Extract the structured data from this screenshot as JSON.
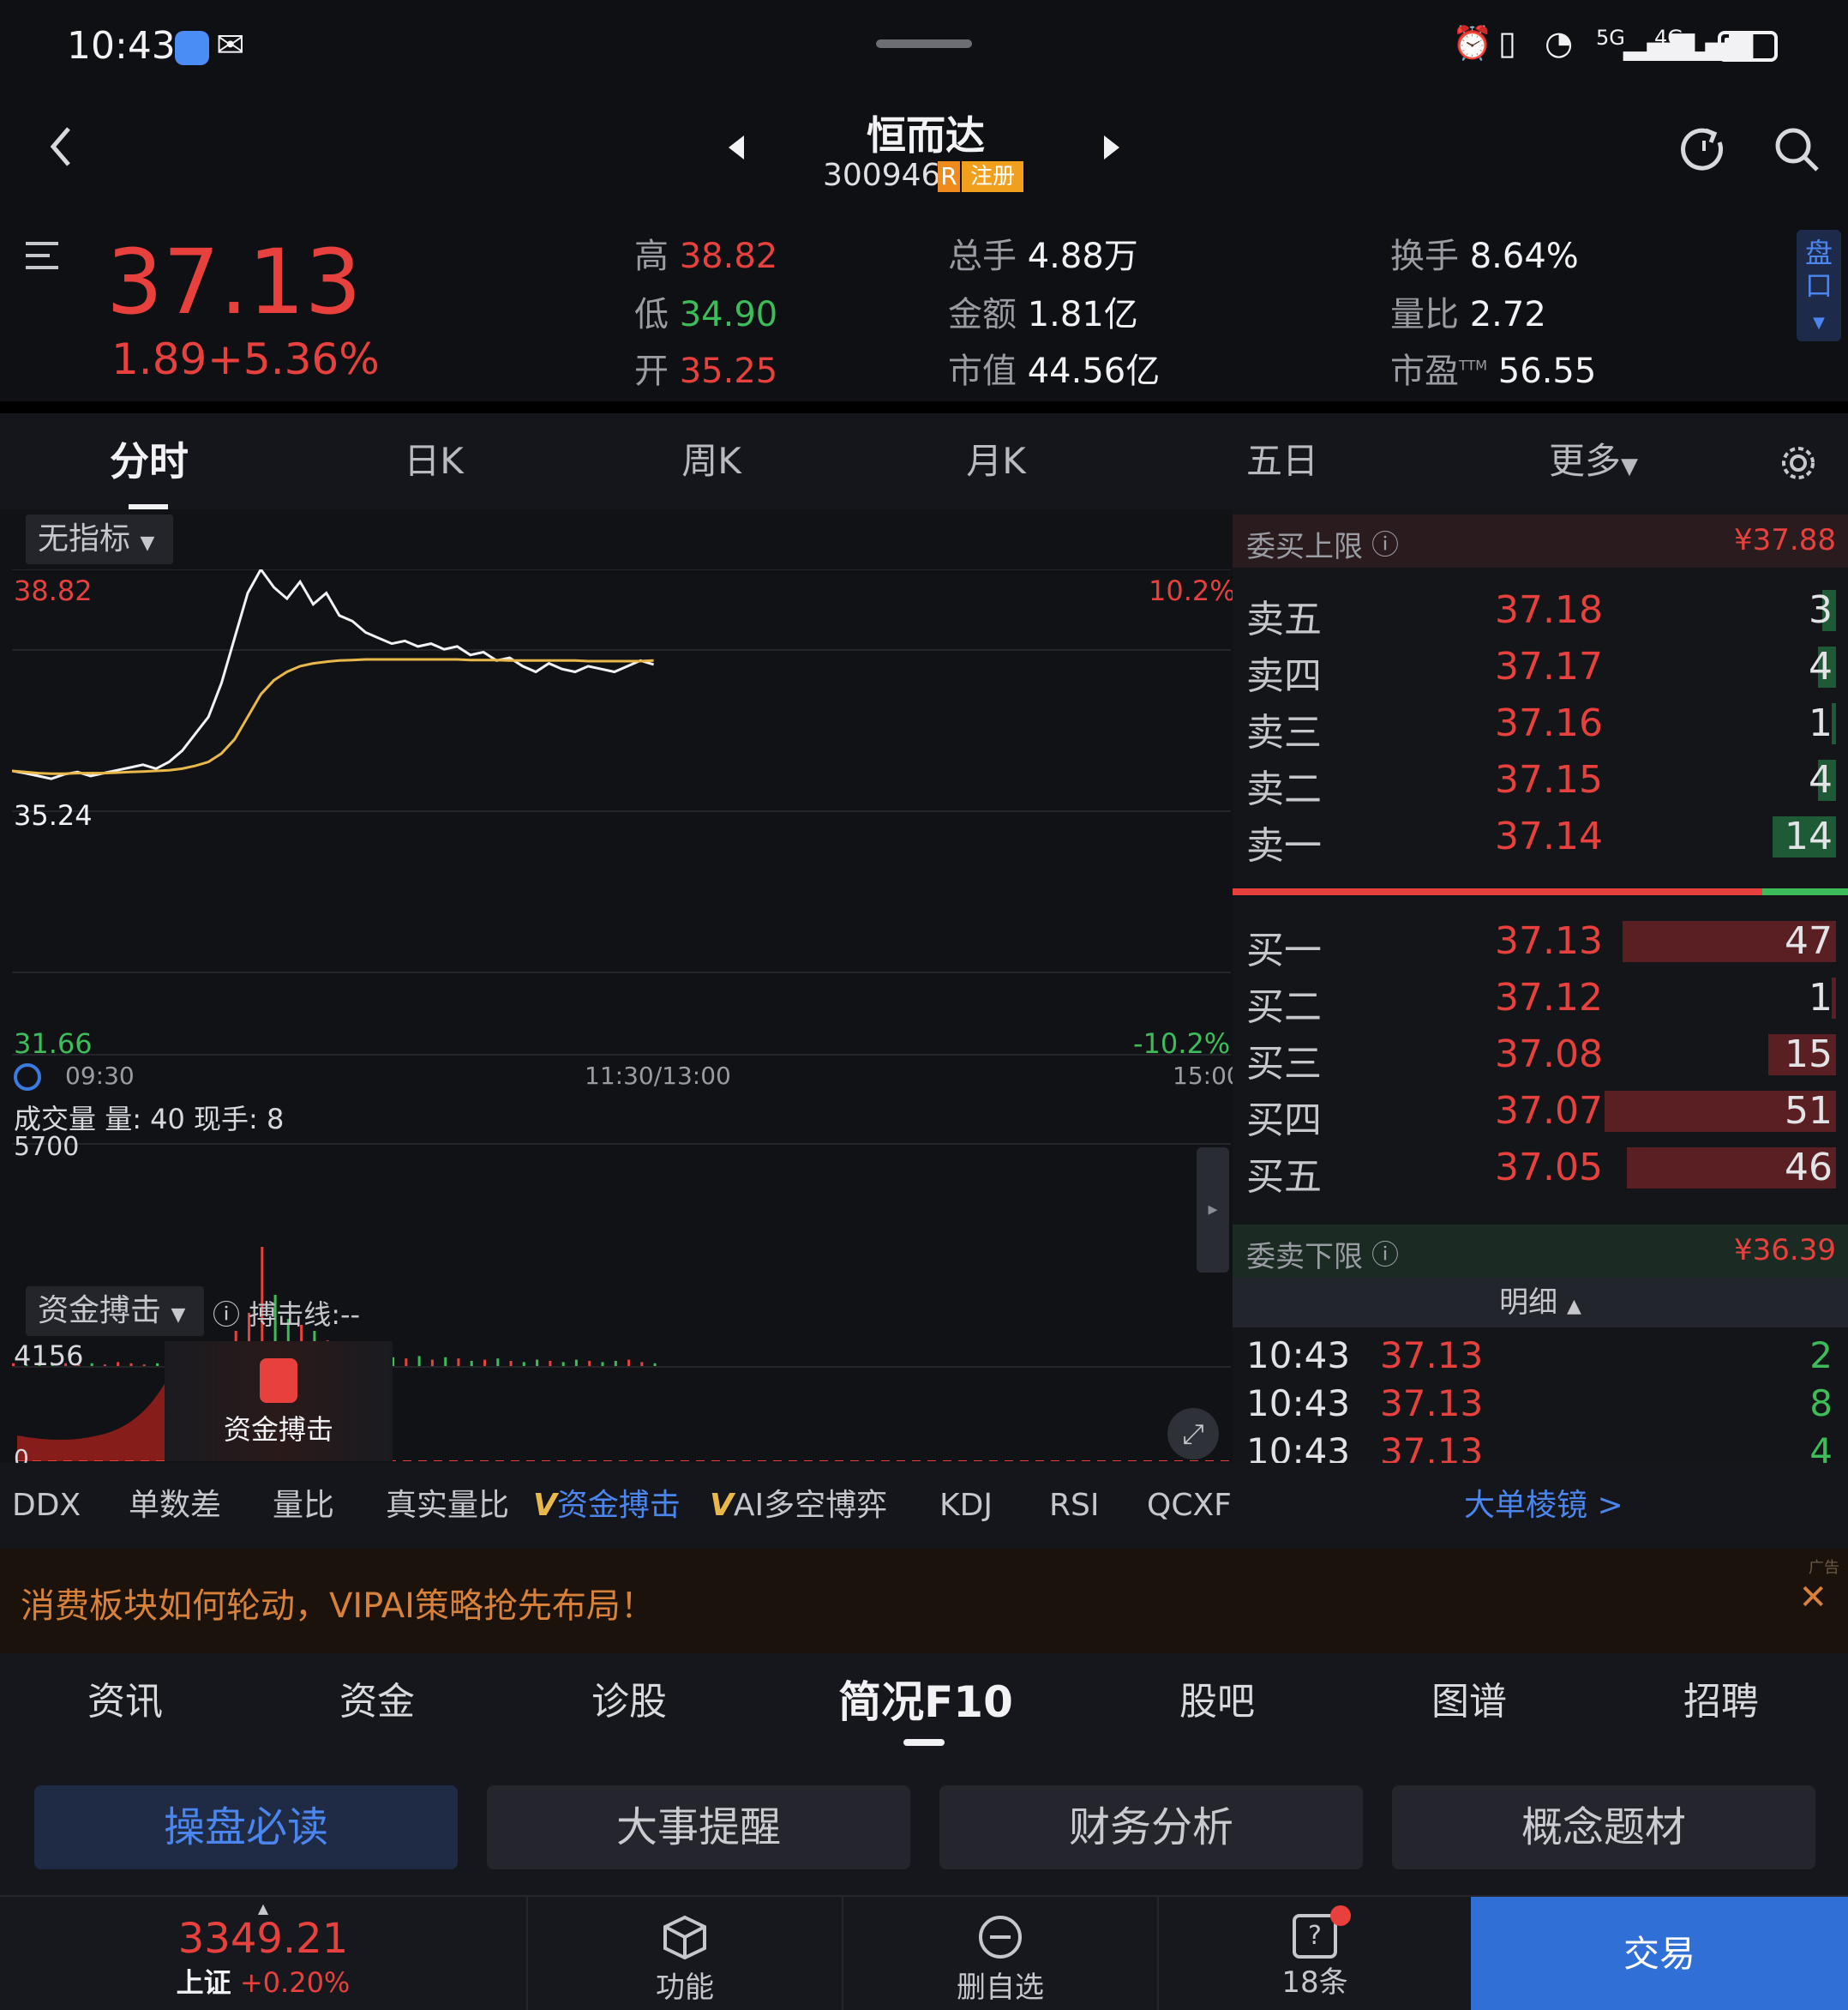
{
  "status": {
    "time": "10:43",
    "net1": "5G",
    "net2": "4G"
  },
  "header": {
    "name": "恒而达",
    "code": "300946",
    "badge_r": "R",
    "badge_reg": "注册"
  },
  "quote": {
    "price": "37.13",
    "change": "1.89",
    "change_pct": "+5.36%",
    "high_label": "高",
    "high": "38.82",
    "low_label": "低",
    "low": "34.90",
    "open_label": "开",
    "open": "35.25",
    "vol_label": "总手",
    "vol": "4.88万",
    "amt_label": "金额",
    "amt": "1.81亿",
    "cap_label": "市值",
    "cap": "44.56亿",
    "turn_label": "换手",
    "turn": "8.64%",
    "ratio_label": "量比",
    "ratio": "2.72",
    "pe_label": "市盈",
    "pe_sup": "TTM",
    "pe": "56.55",
    "panel_label": "盘口"
  },
  "tabs": [
    "分时",
    "日K",
    "周K",
    "月K",
    "五日",
    "更多"
  ],
  "chart": {
    "indicator": "无指标",
    "y_high": "38.82",
    "y_mid": "35.24",
    "y_low": "31.66",
    "pct_high": "10.2%",
    "pct_low": "-10.2%",
    "t_start": "09:30",
    "t_mid": "11:30/13:00",
    "t_end": "15:00",
    "vol_title": "成交量",
    "vol_label": "量:",
    "vol_value": "40",
    "cur_label": "现手:",
    "cur_value": "8",
    "vol_max": "5700",
    "fund_title": "资金搏击",
    "fund_line": "搏击线:--",
    "fund_max": "4156",
    "fund_zero": "0",
    "lock_text": "资金搏击"
  },
  "chart_data": {
    "type": "line",
    "title": "",
    "ylim": [
      31.66,
      38.82
    ],
    "xlabel": "",
    "ylabel": "",
    "series": [
      {
        "values": [
          35.24,
          35.2,
          35.15,
          35.1,
          35.18,
          35.22,
          35.15,
          35.2,
          35.25,
          35.3,
          35.35,
          35.28,
          35.4,
          35.6,
          35.9,
          36.2,
          36.8,
          37.6,
          38.4,
          38.82,
          38.5,
          38.3,
          38.6,
          38.2,
          38.4,
          38.0,
          37.9,
          37.7,
          37.6,
          37.5,
          37.55,
          37.45,
          37.5,
          37.4,
          37.45,
          37.3,
          37.35,
          37.2,
          37.25,
          37.1,
          37.0,
          37.15,
          37.05,
          37.0,
          37.1,
          37.05,
          37.0,
          37.1,
          37.2,
          37.13
        ]
      },
      {
        "values": [
          35.24,
          35.22,
          35.2,
          35.19,
          35.19,
          35.2,
          35.2,
          35.2,
          35.21,
          35.22,
          35.23,
          35.24,
          35.25,
          35.28,
          35.33,
          35.4,
          35.55,
          35.8,
          36.2,
          36.6,
          36.85,
          37.0,
          37.1,
          37.15,
          37.18,
          37.2,
          37.21,
          37.22,
          37.22,
          37.22,
          37.22,
          37.22,
          37.22,
          37.22,
          37.22,
          37.21,
          37.21,
          37.21,
          37.2,
          37.2,
          37.2,
          37.2,
          37.2,
          37.2,
          37.19,
          37.19,
          37.19,
          37.19,
          37.19,
          37.2
        ]
      }
    ],
    "volumes": [
      3,
      2,
      4,
      2,
      3,
      2,
      3,
      2,
      4,
      3,
      2,
      3,
      4,
      5,
      8,
      12,
      20,
      30,
      45,
      100,
      60,
      40,
      35,
      30,
      22,
      18,
      14,
      10,
      9,
      8,
      7,
      9,
      6,
      8,
      7,
      5,
      6,
      7,
      5,
      4,
      6,
      5,
      4,
      6,
      5,
      4,
      5,
      6,
      4,
      3
    ]
  },
  "orderbook": {
    "buy_limit_label": "委买上限",
    "buy_limit": "¥37.88",
    "sell_limit_label": "委卖下限",
    "sell_limit": "¥36.39",
    "asks": [
      {
        "label": "卖五",
        "price": "37.18",
        "qty": "3"
      },
      {
        "label": "卖四",
        "price": "37.17",
        "qty": "4"
      },
      {
        "label": "卖三",
        "price": "37.16",
        "qty": "1"
      },
      {
        "label": "卖二",
        "price": "37.15",
        "qty": "4"
      },
      {
        "label": "卖一",
        "price": "37.14",
        "qty": "14"
      }
    ],
    "bids": [
      {
        "label": "买一",
        "price": "37.13",
        "qty": "47"
      },
      {
        "label": "买二",
        "price": "37.12",
        "qty": "1"
      },
      {
        "label": "买三",
        "price": "37.08",
        "qty": "15"
      },
      {
        "label": "买四",
        "price": "37.07",
        "qty": "51"
      },
      {
        "label": "买五",
        "price": "37.05",
        "qty": "46"
      }
    ],
    "detail_label": "明细",
    "ticks": [
      {
        "time": "10:43",
        "price": "37.13",
        "qty": "2"
      },
      {
        "time": "10:43",
        "price": "37.13",
        "qty": "8"
      },
      {
        "time": "10:43",
        "price": "37.13",
        "qty": "4"
      }
    ]
  },
  "indicators": [
    "DDX",
    "单数差",
    "量比",
    "真实量比",
    "资金搏击",
    "AI多空博弈",
    "KDJ",
    "RSI",
    "QCXF"
  ],
  "big_order": "大单棱镜 >",
  "ad": {
    "text": "消费板块如何轮动，VIPAI策略抢先布局！",
    "tag": "广告"
  },
  "f10_tabs": [
    "资讯",
    "资金",
    "诊股",
    "简况F10",
    "股吧",
    "图谱",
    "招聘"
  ],
  "f10_buttons": [
    "操盘必读",
    "大事提醒",
    "财务分析",
    "概念题材"
  ],
  "bottom": {
    "index_value": "3349.21",
    "index_name": "上证",
    "index_pct": "+0.20%",
    "func": "功能",
    "del": "删自选",
    "msg": "18条",
    "trade": "交易"
  },
  "colors": {
    "up": "#e8413d",
    "down": "#3dbc5a",
    "avg": "#e9b84a",
    "accent": "#3a7be0"
  }
}
